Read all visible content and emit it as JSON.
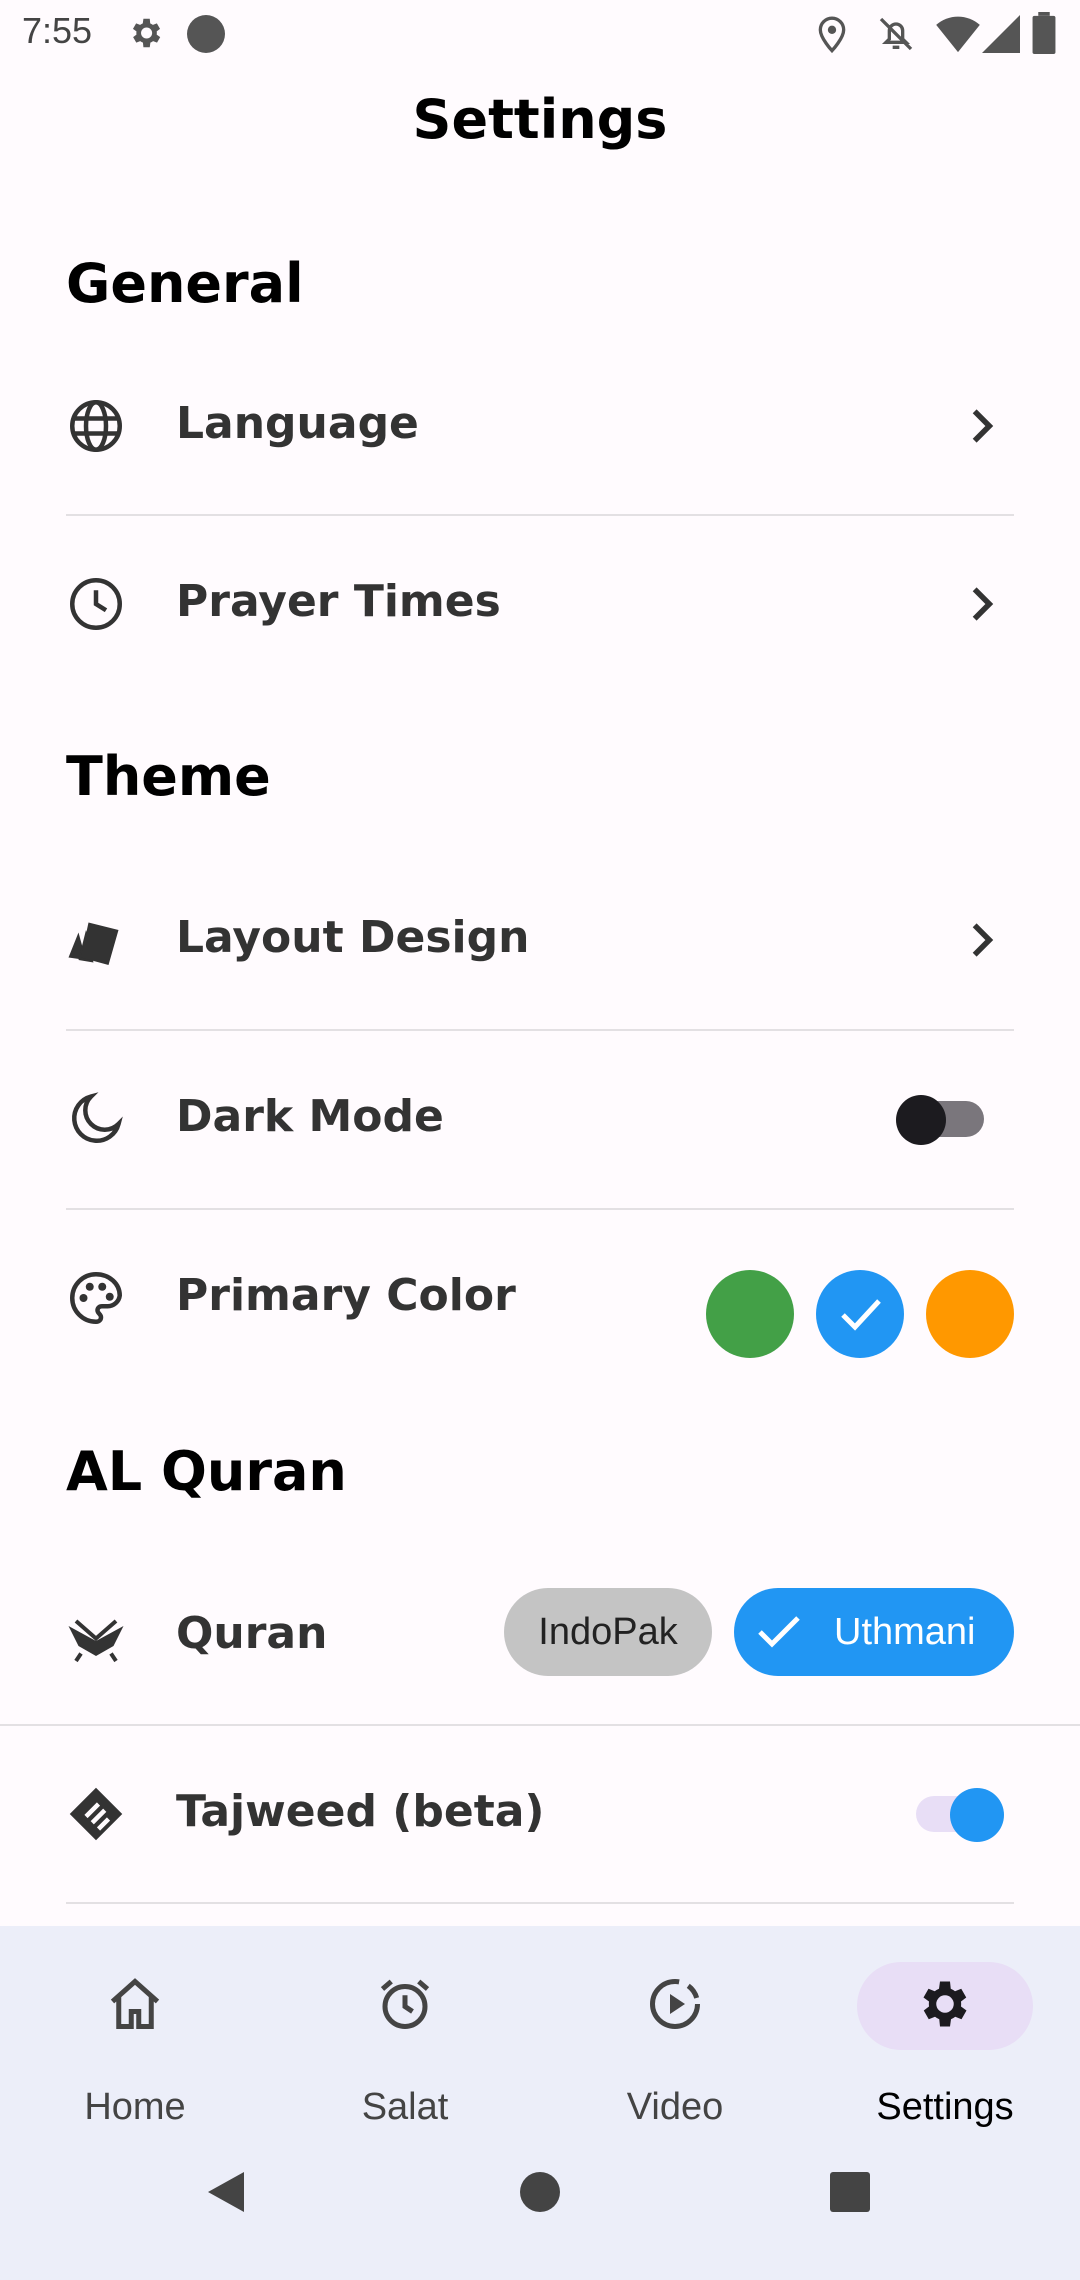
{
  "status_bar": {
    "time": "7:55"
  },
  "app_bar": {
    "title": "Settings"
  },
  "sections": {
    "general": "General",
    "theme": "Theme",
    "quran": "AL Quran"
  },
  "general": {
    "language": {
      "label": "Language",
      "icon": "globe-icon"
    },
    "prayer_times": {
      "label": "Prayer Times",
      "icon": "clock-icon"
    }
  },
  "theme": {
    "layout_design": {
      "label": "Layout Design",
      "icon": "layout-cards-icon"
    },
    "dark_mode": {
      "label": "Dark Mode",
      "icon": "moon-icon",
      "enabled": false
    },
    "primary_color": {
      "label": "Primary Color",
      "icon": "palette-icon",
      "options": [
        "#43A047",
        "#2196F3",
        "#FF9800"
      ],
      "selected": "#2196F3"
    }
  },
  "quran": {
    "quran": {
      "label": "Quran",
      "icon": "open-book-icon",
      "options": [
        "IndoPak",
        "Uthmani"
      ],
      "selected": "Uthmani"
    },
    "tajweed": {
      "label": "Tajweed (beta)",
      "icon": "tajweed-icon",
      "enabled": true
    }
  },
  "bottom_nav": {
    "items": [
      {
        "label": "Home",
        "icon": "home-icon"
      },
      {
        "label": "Salat",
        "icon": "alarm-icon"
      },
      {
        "label": "Video",
        "icon": "play-circle-icon"
      },
      {
        "label": "Settings",
        "icon": "gear-icon"
      }
    ],
    "active": "Settings"
  },
  "colors": {
    "accent": "#2196F3",
    "chip_unselected": "#C4C4C4",
    "nav_bg": "#ECEEF9",
    "nav_pill": "#E8DEF6"
  }
}
